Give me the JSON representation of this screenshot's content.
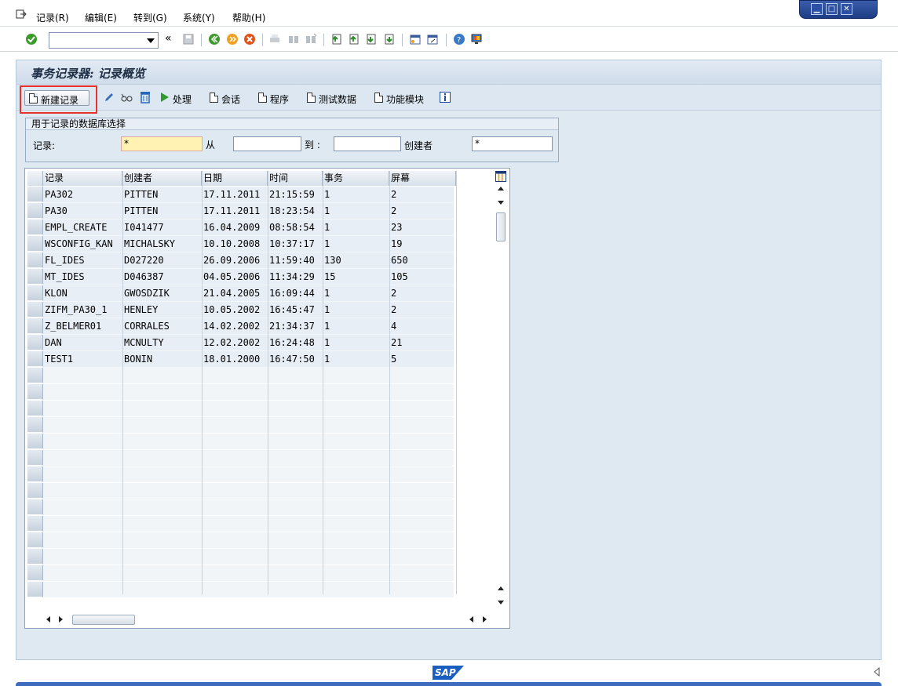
{
  "menu": {
    "items": [
      "记录(R)",
      "编辑(E)",
      "转到(G)",
      "系统(Y)",
      "帮助(H)"
    ]
  },
  "window_controls": {
    "minimize": "▁",
    "maximize": "□",
    "close": "✕"
  },
  "toolbar": {
    "command_value": "",
    "nav_back": "«"
  },
  "page": {
    "title": "事务记录器: 记录概览"
  },
  "app_toolbar": {
    "new_record": "新建记录",
    "process": "处理",
    "session": "会话",
    "program": "程序",
    "test_data": "测试数据",
    "function_module": "功能模块"
  },
  "selection": {
    "header": "用于记录的数据库选择",
    "record_label": "记录:",
    "record_value": "*",
    "from_label": "从",
    "from_value": "",
    "to_label": "到 :",
    "to_value": "",
    "creator_label": "创建者",
    "creator_value": "*"
  },
  "table": {
    "columns": [
      "记录",
      "创建者",
      "日期",
      "时间",
      "事务",
      "屏幕"
    ],
    "rows": [
      [
        "PA302",
        "PITTEN",
        "17.11.2011",
        "21:15:59",
        "1",
        "2"
      ],
      [
        "PA30",
        "PITTEN",
        "17.11.2011",
        "18:23:54",
        "1",
        "2"
      ],
      [
        "EMPL_CREATE",
        "I041477",
        "16.04.2009",
        "08:58:54",
        "1",
        "23"
      ],
      [
        "WSCONFIG_KAN",
        "MICHALSKY",
        "10.10.2008",
        "10:37:17",
        "1",
        "19"
      ],
      [
        "FL_IDES",
        "D027220",
        "26.09.2006",
        "11:59:40",
        "130",
        "650"
      ],
      [
        "MT_IDES",
        "D046387",
        "04.05.2006",
        "11:34:29",
        "15",
        "105"
      ],
      [
        "KLON",
        "GWOSDZIK",
        "21.04.2005",
        "16:09:44",
        "1",
        "2"
      ],
      [
        "ZIFM_PA30_1",
        "HENLEY",
        "10.05.2002",
        "16:45:47",
        "1",
        "2"
      ],
      [
        "Z_BELMER01",
        "CORRALES",
        "14.02.2002",
        "21:34:37",
        "1",
        "4"
      ],
      [
        "DAN",
        "MCNULTY",
        "12.02.2002",
        "16:24:48",
        "1",
        "21"
      ],
      [
        "TEST1",
        "BONIN",
        "18.01.2000",
        "16:47:50",
        "1",
        "5"
      ]
    ]
  },
  "footer": {
    "logo": "SAP"
  },
  "colors": {
    "accent": "#1a5fc0",
    "highlight": "#e8302f",
    "panel": "#dfe9f2"
  }
}
